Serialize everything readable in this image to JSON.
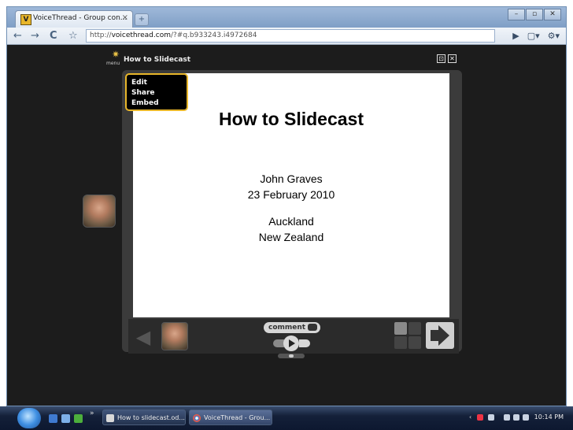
{
  "browser": {
    "tab_title": "VoiceThread - Group con...",
    "tab_close": "×",
    "tab_favicon": "V",
    "address_scheme": "http://",
    "address_host": "voicethread.com",
    "address_path": "/?#q.b933243.i4972684",
    "back_glyph": "←",
    "forward_glyph": "→",
    "reload_glyph": "C",
    "star_glyph": "☆",
    "page_glyph": "▶",
    "doc_glyph": "▢▾",
    "wrench_glyph": "⚙▾",
    "min_glyph": "–",
    "max_glyph": "▫",
    "close_glyph": "✕"
  },
  "voicethread": {
    "menu_label": "menu",
    "title": "How to Slidecast",
    "edit_menu": [
      "Edit",
      "Share",
      "Embed"
    ],
    "comment_label": "comment",
    "fullscreen_glyph": "⊡",
    "close_glyph": "✕"
  },
  "slide": {
    "heading": "How to Slidecast",
    "author": "John Graves",
    "date": "23 February 2010",
    "city": "Auckland",
    "country": "New Zealand"
  },
  "taskbar": {
    "overflow": "»",
    "tasks": [
      "How to slidecast.od...",
      "VoiceThread - Grou..."
    ],
    "clock": "10:14 PM"
  },
  "colors": {
    "accent": "#e8b62a",
    "background": "#1c1c1c"
  }
}
